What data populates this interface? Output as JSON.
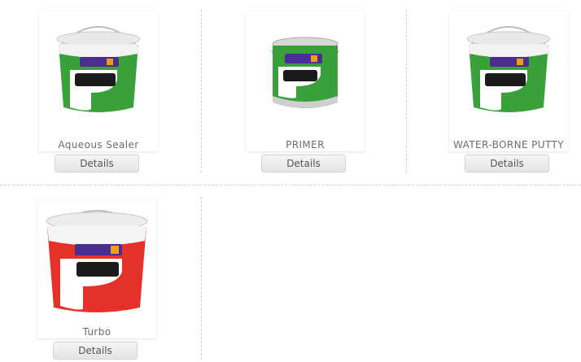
{
  "products": [
    {
      "name": "Aqueous Sealer",
      "details_label": "Details",
      "label_color": "#3aa13a"
    },
    {
      "name": "PRIMER",
      "details_label": "Details",
      "label_color": "#3aa13a"
    },
    {
      "name": "WATER-BORNE PUTTY",
      "details_label": "Details",
      "label_color": "#3aa13a"
    },
    {
      "name": "Turbo",
      "details_label": "Details",
      "label_color": "#e4322b"
    }
  ],
  "brand_color": "#4a2f8f"
}
